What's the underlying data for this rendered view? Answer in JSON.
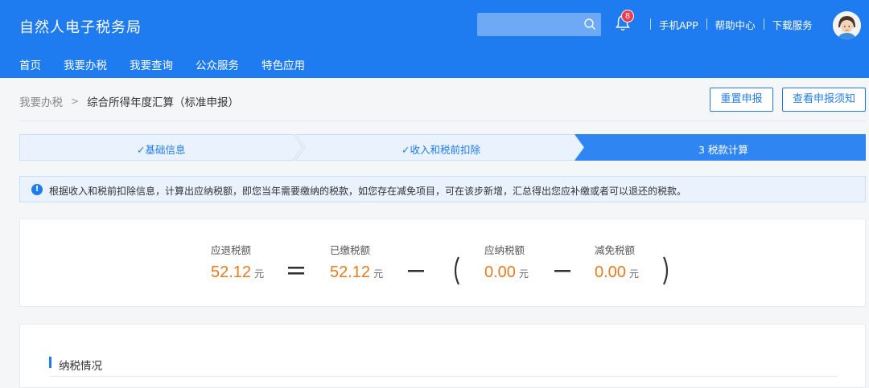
{
  "header": {
    "brand": "自然人电子税务局",
    "search_placeholder": "",
    "notification_count": "8",
    "links": [
      "手机APP",
      "帮助中心",
      "下载服务"
    ],
    "nav": [
      "首页",
      "我要办税",
      "我要查询",
      "公众服务",
      "特色应用"
    ]
  },
  "breadcrumb": {
    "parent": "我要办税",
    "current": "综合所得年度汇算（标准申报）"
  },
  "actions": {
    "reset": "重置申报",
    "view_notice": "查看申报须知"
  },
  "steps": [
    {
      "label": "✓基础信息",
      "state": "done"
    },
    {
      "label": "✓收入和税前扣除",
      "state": "done"
    },
    {
      "label": "3 税款计算",
      "state": "active"
    }
  ],
  "notice": "根据收入和税前扣除信息，计算出应纳税额，即您当年需要缴纳的税款，如您存在减免项目，可在该步新增，汇总得出您应补缴或者可以退还的税款。",
  "formula": {
    "refund": {
      "label": "应退税额",
      "value": "52.12",
      "unit": "元"
    },
    "paid": {
      "label": "已缴税额",
      "value": "52.12",
      "unit": "元"
    },
    "payable": {
      "label": "应纳税额",
      "value": "0.00",
      "unit": "元"
    },
    "exempt": {
      "label": "减免税额",
      "value": "0.00",
      "unit": "元"
    }
  },
  "section": {
    "title": "纳税情况"
  },
  "colors": {
    "primary": "#1f7cf0",
    "amount": "#f07a1a",
    "badge": "#f5364a"
  }
}
